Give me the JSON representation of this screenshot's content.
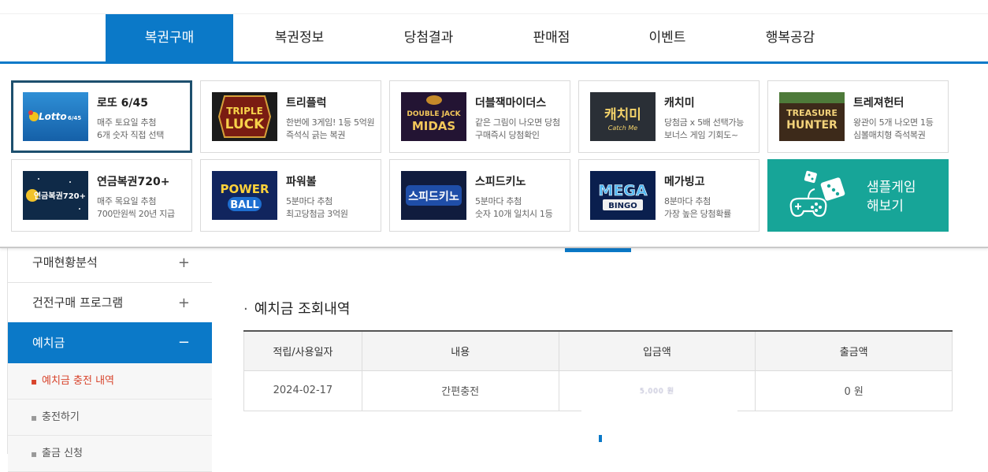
{
  "nav": {
    "tabs": [
      {
        "label": "복권구매"
      },
      {
        "label": "복권정보"
      },
      {
        "label": "당첨결과"
      },
      {
        "label": "판매점"
      },
      {
        "label": "이벤트"
      },
      {
        "label": "행복공감"
      }
    ],
    "active_color": "#0b79c8"
  },
  "games": [
    {
      "name": "로또 6/45",
      "desc1": "매주 토요일 추첨",
      "desc2": "6개 숫자 직접 선택",
      "logo": "Lotto 6/45"
    },
    {
      "name": "트리플럭",
      "desc1": "한번에 3게임! 1등 5억원",
      "desc2": "즉석식 긁는 복권",
      "logo1": "TRIPLE",
      "logo2": "LUCK"
    },
    {
      "name": "더블잭마이더스",
      "desc1": "같은 그림이 나오면 당첨",
      "desc2": "구매즉시 당첨확인",
      "logo1": "DOUBLE JACK",
      "logo2": "MIDAS"
    },
    {
      "name": "캐치미",
      "desc1": "당첨금 x 5배 선택가능",
      "desc2": "보너스 게임 기회도~",
      "logo1": "캐치미",
      "logo2": "Catch Me"
    },
    {
      "name": "트레져헌터",
      "desc1": "왕관이 5개 나오면 1등",
      "desc2": "심볼매치형 즉석복권",
      "logo1": "TREASURE",
      "logo2": "HUNTER"
    },
    {
      "name": "연금복권720+",
      "desc1": "매주 목요일 추첨",
      "desc2": "700만원씩 20년 지급",
      "logo": "연금복권720+"
    },
    {
      "name": "파워볼",
      "desc1": "5분마다 추첨",
      "desc2": "최고당첨금 3억원",
      "logo1": "POWER",
      "logo2": "BALL"
    },
    {
      "name": "스피드키노",
      "desc1": "5분마다 추첨",
      "desc2": "숫자 10개 일치시 1등",
      "logo": "스피드키노"
    },
    {
      "name": "메가빙고",
      "desc1": "8분마다 추첨",
      "desc2": "가장 높은 당첨확률",
      "logo1": "MEGA",
      "logo2": "BINGO"
    }
  ],
  "sample": {
    "line1": "샘플게임",
    "line2": "해보기",
    "color": "#17a598"
  },
  "sidebar": {
    "items": [
      {
        "label": "구매현황분석",
        "sign": "+"
      },
      {
        "label": "건전구매 프로그램",
        "sign": "+"
      },
      {
        "label": "예치금",
        "sign": "−"
      }
    ],
    "subs": [
      {
        "label": "예치금 충전 내역"
      },
      {
        "label": "충전하기"
      },
      {
        "label": "출금 신청"
      }
    ]
  },
  "section": {
    "title": "예치금 조회내역"
  },
  "table": {
    "headers": [
      "적립/사용일자",
      "내용",
      "입금액",
      "출금액"
    ],
    "rows": [
      {
        "date": "2024-02-17",
        "content": "간편충전",
        "deposit": "5,000 원",
        "withdraw": "0 원"
      }
    ]
  }
}
